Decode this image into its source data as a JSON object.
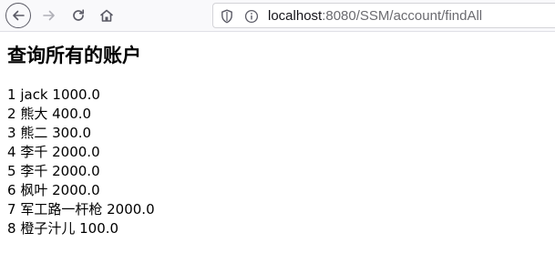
{
  "browser": {
    "url_host": "localhost",
    "url_rest": ":8080/SSM/account/findAll",
    "colors": {
      "toolbar_bg": "#f9f9fb",
      "icon": "#5b5b66",
      "icon_disabled": "#b0b0b7"
    }
  },
  "page": {
    "title": "查询所有的账户",
    "accounts": [
      {
        "id": "1",
        "name": "jack",
        "money": "1000.0"
      },
      {
        "id": "2",
        "name": "熊大",
        "money": "400.0"
      },
      {
        "id": "3",
        "name": "熊二",
        "money": "300.0"
      },
      {
        "id": "4",
        "name": "李千",
        "money": "2000.0"
      },
      {
        "id": "5",
        "name": "李千",
        "money": "2000.0"
      },
      {
        "id": "6",
        "name": "枫叶",
        "money": "2000.0"
      },
      {
        "id": "7",
        "name": "军工路一杆枪",
        "money": "2000.0"
      },
      {
        "id": "8",
        "name": "橙子汁儿",
        "money": "100.0"
      }
    ]
  }
}
